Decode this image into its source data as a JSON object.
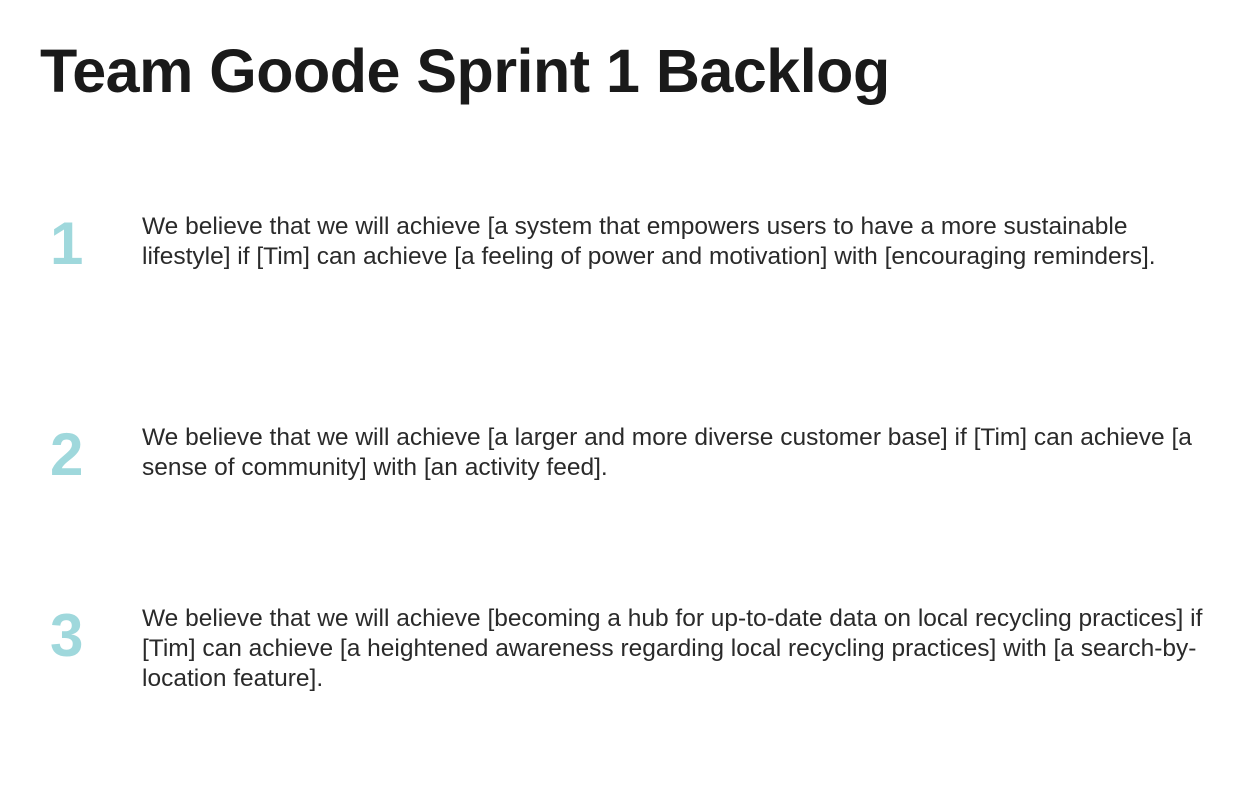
{
  "title": "Team Goode Sprint 1 Backlog",
  "items": [
    {
      "number": "1",
      "text": "We believe that we will achieve [a system that empowers users to have a more sustainable lifestyle] if [Tim] can achieve [a feeling of power and motivation] with [encouraging reminders]."
    },
    {
      "number": "2",
      "text": "We believe that we will achieve [a larger and more diverse customer base] if [Tim] can achieve [a sense of community] with [an activity feed]."
    },
    {
      "number": "3",
      "text": "We believe that we will achieve [becoming a hub for up-to-date data on local recycling practices] if [Tim] can achieve [a heightened awareness regarding local recycling practices] with [a search-by-location feature]."
    }
  ],
  "colors": {
    "number_accent": "#9fd8dc",
    "title": "#1a1a1a",
    "body_text": "#2a2a2a"
  }
}
